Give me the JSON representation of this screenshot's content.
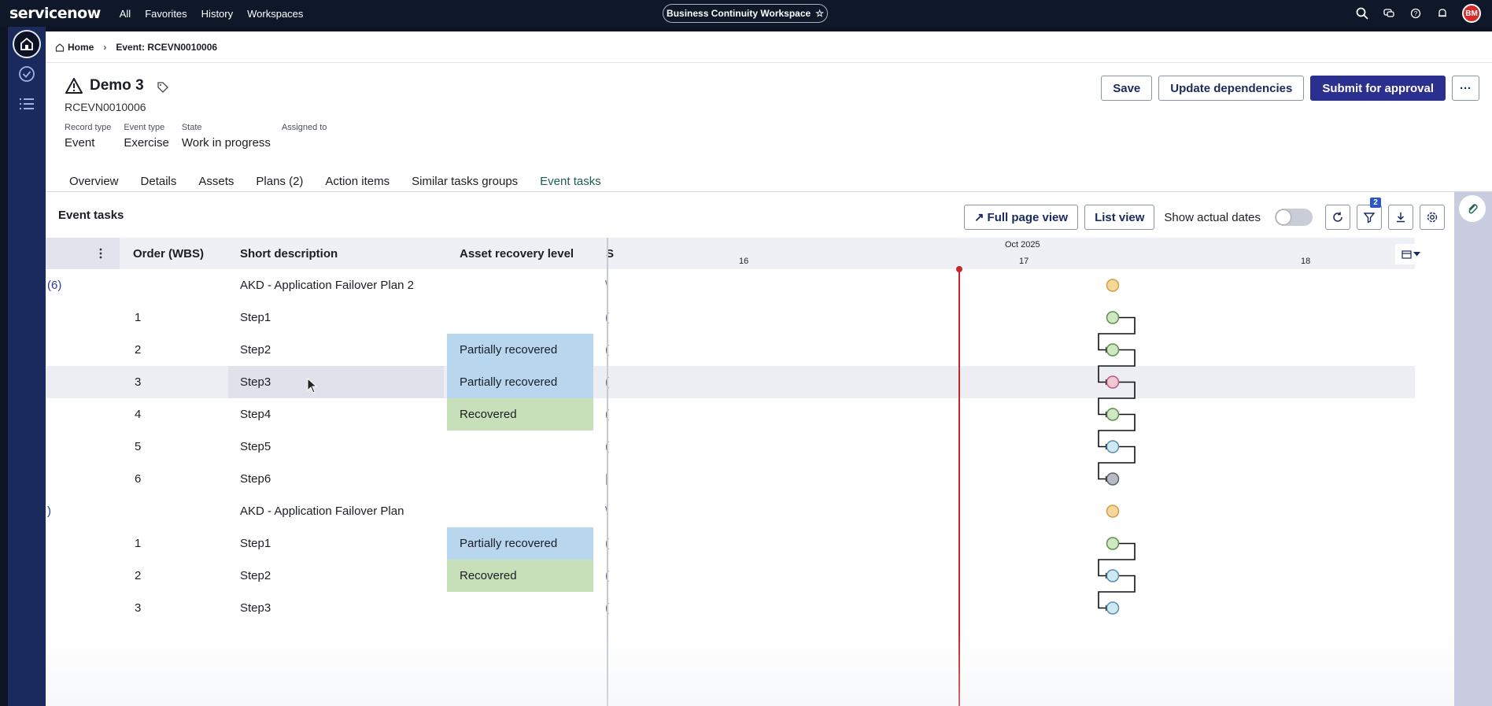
{
  "topnav": {
    "logo": "servicenow",
    "menu": [
      "All",
      "Favorites",
      "History",
      "Workspaces"
    ],
    "workspace": "Business Continuity Workspace",
    "avatar": "BM"
  },
  "breadcrumb": {
    "home": "Home",
    "current": "Event: RCEVN0010006"
  },
  "record": {
    "title": "Demo 3",
    "number": "RCEVN0010006",
    "fields": [
      {
        "label": "Record type",
        "value": "Event"
      },
      {
        "label": "Event type",
        "value": "Exercise"
      },
      {
        "label": "State",
        "value": "Work in progress"
      },
      {
        "label": "Assigned to",
        "value": ""
      }
    ]
  },
  "actions": {
    "save": "Save",
    "update": "Update dependencies",
    "submit": "Submit for approval",
    "more": "···"
  },
  "tabs": [
    "Overview",
    "Details",
    "Assets",
    "Plans (2)",
    "Action items",
    "Similar tasks groups",
    "Event tasks"
  ],
  "panel": {
    "title": "Event tasks",
    "full_page": "Full page view",
    "list_view": "List view",
    "show_actual": "Show actual dates",
    "filter_count": "2"
  },
  "grid": {
    "columns": {
      "order": "Order (WBS)",
      "desc": "Short description",
      "level": "Asset recovery level",
      "trunc": "S"
    },
    "timeline": {
      "month": "Oct 2025",
      "days": [
        "16",
        "17",
        "18"
      ]
    },
    "rows": [
      {
        "group": "(6)",
        "order": "",
        "desc": "AKD - Application Failover Plan 2",
        "level": "",
        "levelType": "",
        "trunc": "\\",
        "marker": "#f6d79a",
        "markerStroke": "#c9a24a"
      },
      {
        "group": "",
        "order": "1",
        "desc": "Step1",
        "level": "",
        "levelType": "",
        "trunc": "(",
        "marker": "#cfe8c2",
        "markerStroke": "#5e8f4c"
      },
      {
        "group": "",
        "order": "2",
        "desc": "Step2",
        "level": "Partially recovered",
        "levelType": "partial",
        "trunc": "(",
        "marker": "#cfe8c2",
        "markerStroke": "#5e8f4c"
      },
      {
        "group": "",
        "order": "3",
        "desc": "Step3",
        "level": "Partially recovered",
        "levelType": "partial",
        "trunc": "(",
        "marker": "#f4c6d3",
        "markerStroke": "#b06080"
      },
      {
        "group": "",
        "order": "4",
        "desc": "Step4",
        "level": "Recovered",
        "levelType": "recov",
        "trunc": "(",
        "marker": "#cfe8c2",
        "markerStroke": "#5e8f4c"
      },
      {
        "group": "",
        "order": "5",
        "desc": "Step5",
        "level": "",
        "levelType": "",
        "trunc": "(",
        "marker": "#cfe9f4",
        "markerStroke": "#5a8ea8"
      },
      {
        "group": "",
        "order": "6",
        "desc": "Step6",
        "level": "",
        "levelType": "",
        "trunc": "|",
        "marker": "#b6bcc6",
        "markerStroke": "#5b606a"
      },
      {
        "group": ")",
        "order": "",
        "desc": "AKD - Application Failover Plan",
        "level": "",
        "levelType": "",
        "trunc": "\\",
        "marker": "#f6d79a",
        "markerStroke": "#c9a24a"
      },
      {
        "group": "",
        "order": "1",
        "desc": "Step1",
        "level": "Partially recovered",
        "levelType": "partial",
        "trunc": "(",
        "marker": "#cfe8c2",
        "markerStroke": "#5e8f4c"
      },
      {
        "group": "",
        "order": "2",
        "desc": "Step2",
        "level": "Recovered",
        "levelType": "recov",
        "trunc": "(",
        "marker": "#cfe9f4",
        "markerStroke": "#5a8ea8"
      },
      {
        "group": "",
        "order": "3",
        "desc": "Step3",
        "level": "",
        "levelType": "",
        "trunc": "(",
        "marker": "#cfe9f4",
        "markerStroke": "#5a8ea8"
      }
    ]
  }
}
